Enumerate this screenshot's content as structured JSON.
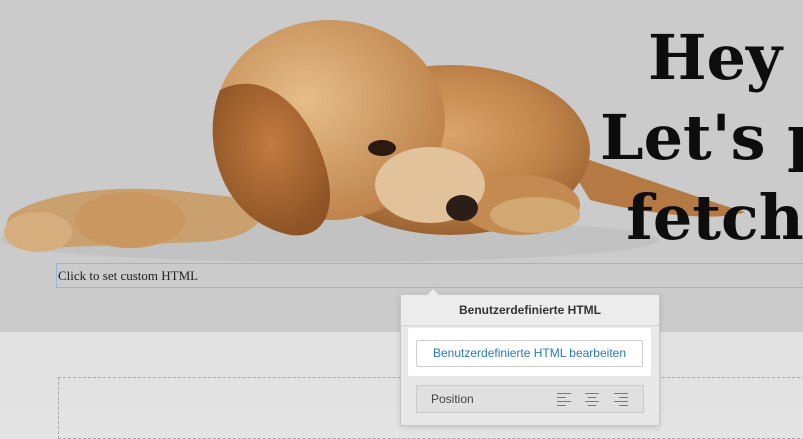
{
  "hero": {
    "headline_lines": [
      "Hey",
      "Let's p",
      "fetch"
    ]
  },
  "custom_html_field": {
    "label": "Click to set custom HTML"
  },
  "popup": {
    "title": "Benutzerdefinierte HTML",
    "edit_button_label": "Benutzerdefinierte HTML bearbeiten",
    "position_label": "Position",
    "align_icons": [
      "align-left-icon",
      "align-center-icon",
      "align-right-icon"
    ]
  },
  "colors": {
    "accent": "#2b78c5",
    "hero_bg": "#cbcbcb"
  }
}
